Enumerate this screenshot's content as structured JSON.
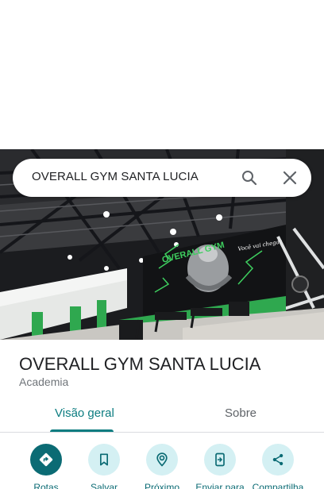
{
  "search": {
    "query": "OVERALL GYM SANTA LUCIA"
  },
  "place": {
    "name": "OVERALL GYM SANTA LUCIA",
    "category": "Academia",
    "photo_mural_text": "OVERALL GYM"
  },
  "tabs": [
    {
      "label": "Visão geral",
      "active": true
    },
    {
      "label": "Sobre",
      "active": false
    }
  ],
  "actions": [
    {
      "label": "Rotas",
      "icon": "directions-icon"
    },
    {
      "label": "Salvar",
      "icon": "bookmark-icon"
    },
    {
      "label": "Próximo",
      "icon": "nearby-icon"
    },
    {
      "label": "Enviar para",
      "icon": "send-to-phone-icon"
    },
    {
      "label": "Compartilha",
      "icon": "share-icon"
    }
  ],
  "colors": {
    "accent": "#0b7c80",
    "action_bg": "#d4f0f3",
    "primary_action": "#0b6b74",
    "gym_green": "#2fa84f"
  }
}
